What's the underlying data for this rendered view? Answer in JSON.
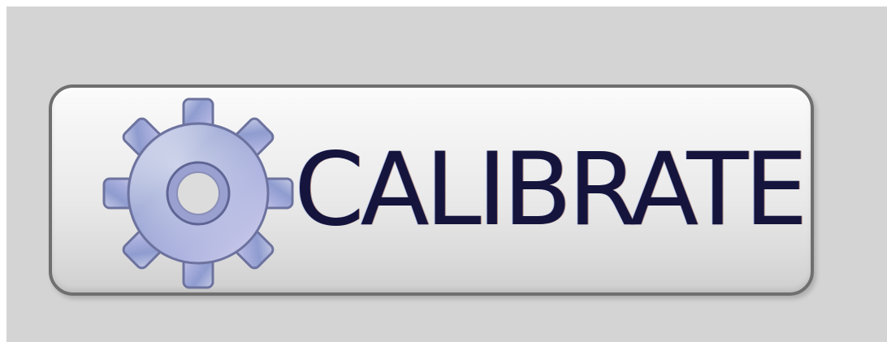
{
  "calibrate_button": {
    "label": "CALIBRATE",
    "icon": "gear-icon"
  }
}
